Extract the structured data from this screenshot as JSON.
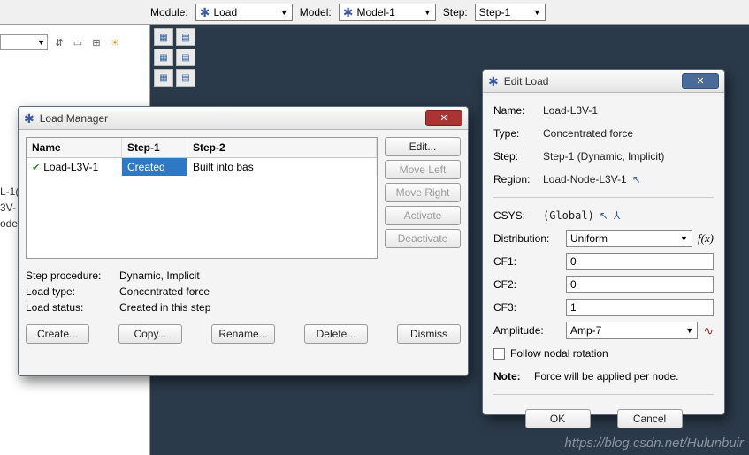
{
  "toolbar": {
    "module_label": "Module:",
    "module_value": "Load",
    "model_label": "Model:",
    "model_value": "Model-1",
    "step_label": "Step:",
    "step_value": "Step-1"
  },
  "left_tree": {
    "line1": "L-1(",
    "line2": "3V-",
    "line3": "ode"
  },
  "load_manager": {
    "title": "Load Manager",
    "columns": {
      "name": "Name",
      "step1": "Step-1",
      "step2": "Step-2"
    },
    "row": {
      "name": "Load-L3V-1",
      "step1": "Created",
      "step2": "Built into bas"
    },
    "side_buttons": {
      "edit": "Edit...",
      "move_left": "Move Left",
      "move_right": "Move Right",
      "activate": "Activate",
      "deactivate": "Deactivate"
    },
    "info": {
      "step_proc_label": "Step procedure:",
      "step_proc_value": "Dynamic, Implicit",
      "load_type_label": "Load type:",
      "load_type_value": "Concentrated force",
      "load_status_label": "Load status:",
      "load_status_value": "Created in this step"
    },
    "bottom_buttons": {
      "create": "Create...",
      "copy": "Copy...",
      "rename": "Rename...",
      "delete": "Delete...",
      "dismiss": "Dismiss"
    }
  },
  "edit_load": {
    "title": "Edit Load",
    "name_label": "Name:",
    "name_value": "Load-L3V-1",
    "type_label": "Type:",
    "type_value": "Concentrated force",
    "step_label": "Step:",
    "step_value": "Step-1 (Dynamic, Implicit)",
    "region_label": "Region:",
    "region_value": "Load-Node-L3V-1",
    "csys_label": "CSYS:",
    "csys_value": "(Global)",
    "distribution_label": "Distribution:",
    "distribution_value": "Uniform",
    "fx": "f(x)",
    "cf1_label": "CF1:",
    "cf1_value": "0",
    "cf2_label": "CF2:",
    "cf2_value": "0",
    "cf3_label": "CF3:",
    "cf3_value": "1",
    "amplitude_label": "Amplitude:",
    "amplitude_value": "Amp-7",
    "follow_label": "Follow nodal rotation",
    "note_label": "Note:",
    "note_value": "Force will be applied per node.",
    "ok": "OK",
    "cancel": "Cancel"
  },
  "watermark": "https://blog.csdn.net/Hulunbuir"
}
